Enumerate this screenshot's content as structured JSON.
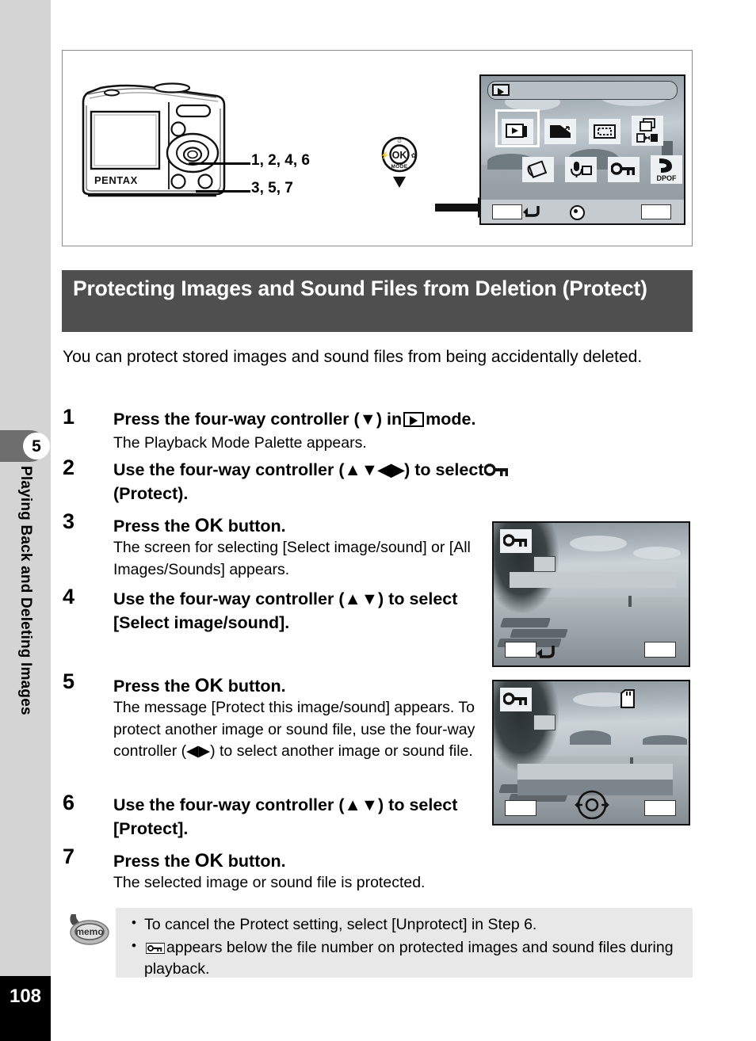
{
  "sidebar": {
    "chapter_number": "5",
    "chapter_title": "Playing Back and Deleting Images",
    "page_number": "108"
  },
  "figure": {
    "camera_brand": "PENTAX",
    "callout_top": "1, 2, 4, 6",
    "callout_bottom": "3, 5, 7",
    "four_way_controller": {
      "center_label": "OK",
      "mode_label": "MODE"
    },
    "palette_screen": {
      "mode_icon": "playback-icon",
      "icons": [
        "slideshow-icon",
        "resize-icon",
        "cropping-icon",
        "image-copy-icon",
        "image-rotation-icon",
        "voice-memo-icon",
        "protect-key-icon",
        "dpof-icon"
      ],
      "dpof_label": "DPOF",
      "selected_index": 0
    }
  },
  "section": {
    "heading": "Protecting Images and Sound Files from Deletion (Protect)",
    "intro": "You can protect stored images and sound files from being accidentally deleted."
  },
  "steps": [
    {
      "number": "1",
      "title_before": "Press the four-way controller (▼) in",
      "title_icon": "playback-icon",
      "title_after": "mode.",
      "description": "The Playback Mode Palette appears."
    },
    {
      "number": "2",
      "title_before": "Use the four-way controller (▲▼◀▶) to select",
      "title_icon": "protect-key-icon",
      "title_after": "(Protect).",
      "description": ""
    },
    {
      "number": "3",
      "title_before": "Press the",
      "title_icon": "ok-button",
      "title_ok": "OK",
      "title_after": "button.",
      "description": "The screen for selecting [Select image/sound] or [All Images/Sounds] appears."
    },
    {
      "number": "4",
      "title_before": "Use the four-way controller (▲▼) to select [Select image/sound].",
      "title_after": "",
      "description": ""
    },
    {
      "number": "5",
      "title_before": "Press the",
      "title_ok": "OK",
      "title_after": "button.",
      "description": "The message [Protect this image/sound] appears. To protect another image or sound file, use the four-way controller (◀▶) to select another image or sound file."
    },
    {
      "number": "6",
      "title_before": "Use the four-way controller (▲▼) to select [Protect].",
      "title_after": "",
      "description": ""
    },
    {
      "number": "7",
      "title_before": "Press the",
      "title_ok": "OK",
      "title_after": "button.",
      "description": "The selected image or sound file is protected."
    }
  ],
  "screenshots": [
    {
      "name": "protect-select-screen",
      "key_icon": "protect-key-icon",
      "menu_rows": 1,
      "has_back_arrow": true,
      "has_sd_icon": false,
      "has_four_way_hint": false
    },
    {
      "name": "protect-confirm-screen",
      "key_icon": "protect-key-icon",
      "menu_rows": 2,
      "has_back_arrow": false,
      "has_sd_icon": true,
      "has_four_way_hint": true
    }
  ],
  "memo": {
    "icon_label": "memo",
    "items": [
      {
        "before": "To cancel the Protect setting, select [Unprotect] in Step 6.",
        "icon": null,
        "after": ""
      },
      {
        "before": "",
        "icon": "protect-key-icon",
        "after": "appears below the file number on protected images and sound files during playback."
      }
    ]
  },
  "colors": {
    "sidebar_bg": "#d4d4d4",
    "chapter_tab": "#6e6e6e",
    "heading_bg": "#4f4f4f",
    "memo_bg": "#e8e8e8",
    "page_box_bg": "#000000"
  }
}
